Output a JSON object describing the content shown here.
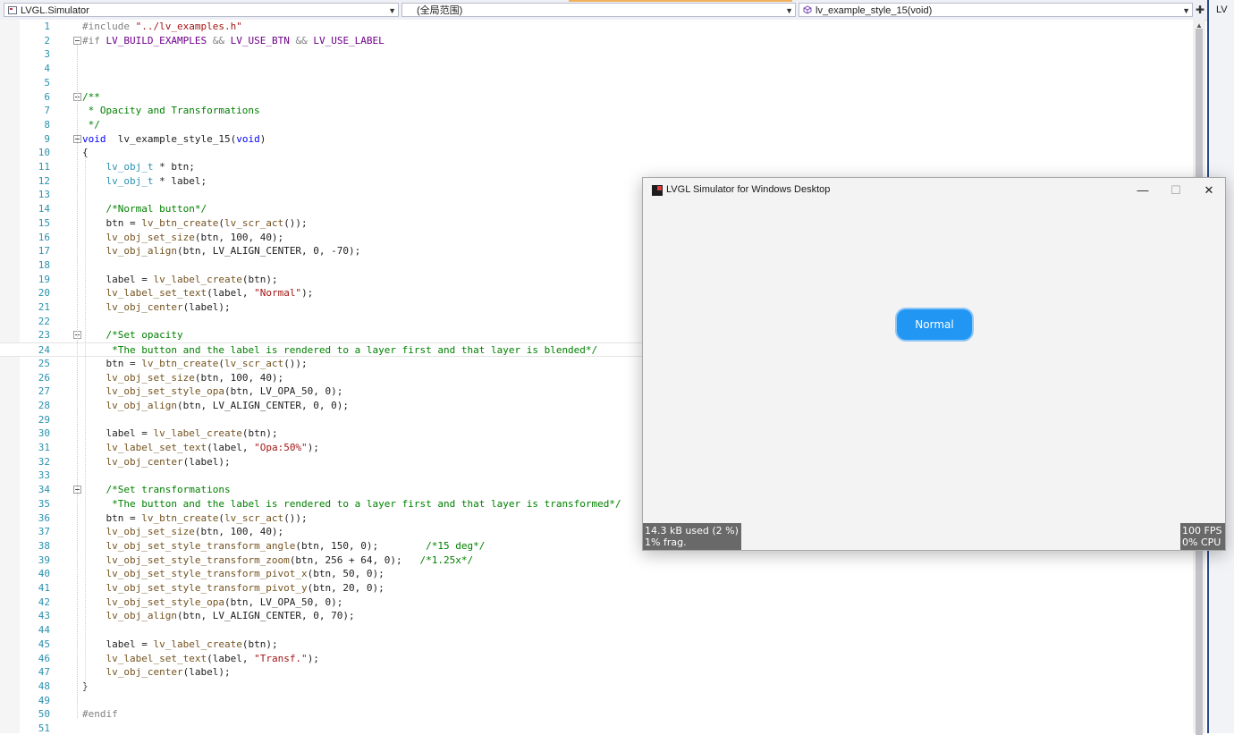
{
  "navbar": {
    "project": "LVGL.Simulator",
    "scope": "(全局范围)",
    "member": "lv_example_style_15(void)",
    "side_project": "LV"
  },
  "editor": {
    "current_line": 24,
    "lines": [
      {
        "n": "1",
        "t": [
          [
            "pp",
            "#include "
          ],
          [
            "str",
            "\"../lv_examples.h\""
          ]
        ]
      },
      {
        "n": "2",
        "fold": true,
        "t": [
          [
            "pp",
            "#if "
          ],
          [
            "mac",
            "LV_BUILD_EXAMPLES"
          ],
          [
            "pp",
            " && "
          ],
          [
            "mac",
            "LV_USE_BTN"
          ],
          [
            "pp",
            " && "
          ],
          [
            "mac",
            "LV_USE_LABEL"
          ]
        ]
      },
      {
        "n": "3",
        "t": []
      },
      {
        "n": "4",
        "t": []
      },
      {
        "n": "5",
        "t": []
      },
      {
        "n": "6",
        "fold": true,
        "t": [
          [
            "cm",
            "/**"
          ]
        ]
      },
      {
        "n": "7",
        "t": [
          [
            "cm",
            " * Opacity and Transformations"
          ]
        ]
      },
      {
        "n": "8",
        "t": [
          [
            "cm",
            " */"
          ]
        ]
      },
      {
        "n": "9",
        "fold": true,
        "t": [
          [
            "kw",
            "void"
          ],
          [
            "",
            "  lv_example_style_15("
          ],
          [
            "kw",
            "void"
          ],
          [
            "",
            ")"
          ]
        ]
      },
      {
        "n": "10",
        "t": [
          [
            "",
            "{"
          ]
        ]
      },
      {
        "n": "11",
        "t": [
          [
            "",
            "    "
          ],
          [
            "ty",
            "lv_obj_t"
          ],
          [
            "",
            " * btn;"
          ]
        ]
      },
      {
        "n": "12",
        "t": [
          [
            "",
            "    "
          ],
          [
            "ty",
            "lv_obj_t"
          ],
          [
            "",
            " * label;"
          ]
        ]
      },
      {
        "n": "13",
        "t": []
      },
      {
        "n": "14",
        "t": [
          [
            "",
            "    "
          ],
          [
            "cm",
            "/*Normal button*/"
          ]
        ]
      },
      {
        "n": "15",
        "t": [
          [
            "",
            "    btn = "
          ],
          [
            "fn",
            "lv_btn_create"
          ],
          [
            "",
            "("
          ],
          [
            "fn",
            "lv_scr_act"
          ],
          [
            "",
            "());"
          ]
        ]
      },
      {
        "n": "16",
        "t": [
          [
            "",
            "    "
          ],
          [
            "fn",
            "lv_obj_set_size"
          ],
          [
            "",
            "(btn, 100, 40);"
          ]
        ]
      },
      {
        "n": "17",
        "t": [
          [
            "",
            "    "
          ],
          [
            "fn",
            "lv_obj_align"
          ],
          [
            "",
            "(btn, LV_ALIGN_CENTER, 0, -70);"
          ]
        ]
      },
      {
        "n": "18",
        "t": []
      },
      {
        "n": "19",
        "t": [
          [
            "",
            "    label = "
          ],
          [
            "fn",
            "lv_label_create"
          ],
          [
            "",
            "(btn);"
          ]
        ]
      },
      {
        "n": "20",
        "t": [
          [
            "",
            "    "
          ],
          [
            "fn",
            "lv_label_set_text"
          ],
          [
            "",
            "(label, "
          ],
          [
            "str",
            "\"Normal\""
          ],
          [
            "",
            ");"
          ]
        ]
      },
      {
        "n": "21",
        "t": [
          [
            "",
            "    "
          ],
          [
            "fn",
            "lv_obj_center"
          ],
          [
            "",
            "(label);"
          ]
        ]
      },
      {
        "n": "22",
        "t": []
      },
      {
        "n": "23",
        "fold": true,
        "t": [
          [
            "",
            "    "
          ],
          [
            "cm",
            "/*Set opacity"
          ]
        ]
      },
      {
        "n": "24",
        "t": [
          [
            "",
            "     "
          ],
          [
            "cm",
            "*The button and the label is rendered to a layer first and that layer is blended*/"
          ]
        ]
      },
      {
        "n": "25",
        "t": [
          [
            "",
            "    btn = "
          ],
          [
            "fn",
            "lv_btn_create"
          ],
          [
            "",
            "("
          ],
          [
            "fn",
            "lv_scr_act"
          ],
          [
            "",
            "());"
          ]
        ]
      },
      {
        "n": "26",
        "t": [
          [
            "",
            "    "
          ],
          [
            "fn",
            "lv_obj_set_size"
          ],
          [
            "",
            "(btn, 100, 40);"
          ]
        ]
      },
      {
        "n": "27",
        "t": [
          [
            "",
            "    "
          ],
          [
            "fn",
            "lv_obj_set_style_opa"
          ],
          [
            "",
            "(btn, LV_OPA_50, 0);"
          ]
        ]
      },
      {
        "n": "28",
        "t": [
          [
            "",
            "    "
          ],
          [
            "fn",
            "lv_obj_align"
          ],
          [
            "",
            "(btn, LV_ALIGN_CENTER, 0, 0);"
          ]
        ]
      },
      {
        "n": "29",
        "t": []
      },
      {
        "n": "30",
        "t": [
          [
            "",
            "    label = "
          ],
          [
            "fn",
            "lv_label_create"
          ],
          [
            "",
            "(btn);"
          ]
        ]
      },
      {
        "n": "31",
        "t": [
          [
            "",
            "    "
          ],
          [
            "fn",
            "lv_label_set_text"
          ],
          [
            "",
            "(label, "
          ],
          [
            "str",
            "\"Opa:50%\""
          ],
          [
            "",
            ");"
          ]
        ]
      },
      {
        "n": "32",
        "t": [
          [
            "",
            "    "
          ],
          [
            "fn",
            "lv_obj_center"
          ],
          [
            "",
            "(label);"
          ]
        ]
      },
      {
        "n": "33",
        "t": []
      },
      {
        "n": "34",
        "fold": true,
        "t": [
          [
            "",
            "    "
          ],
          [
            "cm",
            "/*Set transformations"
          ]
        ]
      },
      {
        "n": "35",
        "t": [
          [
            "",
            "     "
          ],
          [
            "cm",
            "*The button and the label is rendered to a layer first and that layer is transformed*/"
          ]
        ]
      },
      {
        "n": "36",
        "t": [
          [
            "",
            "    btn = "
          ],
          [
            "fn",
            "lv_btn_create"
          ],
          [
            "",
            "("
          ],
          [
            "fn",
            "lv_scr_act"
          ],
          [
            "",
            "());"
          ]
        ]
      },
      {
        "n": "37",
        "t": [
          [
            "",
            "    "
          ],
          [
            "fn",
            "lv_obj_set_size"
          ],
          [
            "",
            "(btn, 100, 40);"
          ]
        ]
      },
      {
        "n": "38",
        "t": [
          [
            "",
            "    "
          ],
          [
            "fn",
            "lv_obj_set_style_transform_angle"
          ],
          [
            "",
            "(btn, 150, 0);        "
          ],
          [
            "cm",
            "/*15 deg*/"
          ]
        ]
      },
      {
        "n": "39",
        "t": [
          [
            "",
            "    "
          ],
          [
            "fn",
            "lv_obj_set_style_transform_zoom"
          ],
          [
            "",
            "(btn, 256 + 64, 0);   "
          ],
          [
            "cm",
            "/*1.25x*/"
          ]
        ]
      },
      {
        "n": "40",
        "t": [
          [
            "",
            "    "
          ],
          [
            "fn",
            "lv_obj_set_style_transform_pivot_x"
          ],
          [
            "",
            "(btn, 50, 0);"
          ]
        ]
      },
      {
        "n": "41",
        "t": [
          [
            "",
            "    "
          ],
          [
            "fn",
            "lv_obj_set_style_transform_pivot_y"
          ],
          [
            "",
            "(btn, 20, 0);"
          ]
        ]
      },
      {
        "n": "42",
        "t": [
          [
            "",
            "    "
          ],
          [
            "fn",
            "lv_obj_set_style_opa"
          ],
          [
            "",
            "(btn, LV_OPA_50, 0);"
          ]
        ]
      },
      {
        "n": "43",
        "t": [
          [
            "",
            "    "
          ],
          [
            "fn",
            "lv_obj_align"
          ],
          [
            "",
            "(btn, LV_ALIGN_CENTER, 0, 70);"
          ]
        ]
      },
      {
        "n": "44",
        "t": []
      },
      {
        "n": "45",
        "t": [
          [
            "",
            "    label = "
          ],
          [
            "fn",
            "lv_label_create"
          ],
          [
            "",
            "(btn);"
          ]
        ]
      },
      {
        "n": "46",
        "t": [
          [
            "",
            "    "
          ],
          [
            "fn",
            "lv_label_set_text"
          ],
          [
            "",
            "(label, "
          ],
          [
            "str",
            "\"Transf.\""
          ],
          [
            "",
            ");"
          ]
        ]
      },
      {
        "n": "47",
        "t": [
          [
            "",
            "    "
          ],
          [
            "fn",
            "lv_obj_center"
          ],
          [
            "",
            "(label);"
          ]
        ]
      },
      {
        "n": "48",
        "t": [
          [
            "",
            "}"
          ]
        ]
      },
      {
        "n": "49",
        "t": []
      },
      {
        "n": "50",
        "t": [
          [
            "pp",
            "#endif"
          ]
        ]
      },
      {
        "n": "51",
        "t": []
      }
    ]
  },
  "simulator": {
    "title": "LVGL Simulator for Windows Desktop",
    "minimize_glyph": "—",
    "maximize_glyph": "☐",
    "close_glyph": "✕",
    "button_label": "Normal",
    "mem_used": "14.3 kB used (2 %)",
    "mem_frag": "1% frag.",
    "fps": "100 FPS",
    "cpu": "0% CPU",
    "button_color": "#2196f3"
  },
  "icons": {
    "project": "project-icon",
    "member": "cube-icon",
    "pin": "pin-icon"
  }
}
